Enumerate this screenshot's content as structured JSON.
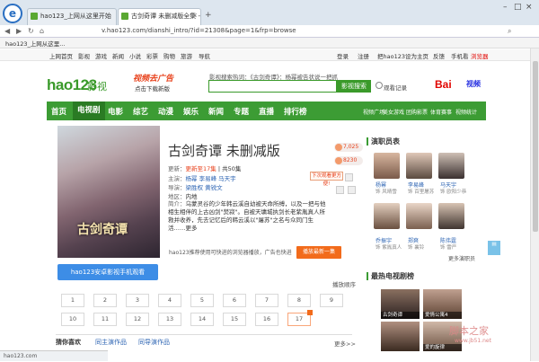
{
  "tabs": [
    {
      "label": "hao123_上网从这里开始"
    },
    {
      "label": "古剑奇谭 未删减版全集 - 更新"
    }
  ],
  "browser": {
    "url": "v.hao123.com/dianshi_intro/?id=21308&page=1&frp=browse",
    "favorite": "hao123_上网从这里..."
  },
  "topnav": {
    "items": [
      "上网首页",
      "影视",
      "游戏",
      "新闻",
      "小说",
      "彩票",
      "购物",
      "旅游",
      "导航"
    ],
    "right": [
      "登录",
      "注册",
      "把hao123设为主页",
      "反馈",
      "手机看",
      "浏览器"
    ]
  },
  "header": {
    "logo": "hao123",
    "logo_sub": "影视",
    "promo": "视频去广告",
    "promo_sub": "点击下载新版",
    "search_hint": "影视搜索热词：《古剑奇谭》：杨幂被告状说一把抓",
    "search_button": "影视搜索",
    "history": "观看记录",
    "baidu": "Bai",
    "baidu_sub": "视频"
  },
  "mainnav": {
    "items": [
      "首页",
      "电视剧",
      "电影",
      "综艺",
      "动漫",
      "娱乐",
      "新闻",
      "专题",
      "直播",
      "排行榜"
    ],
    "sub": [
      "视频广场",
      "美女",
      "游戏",
      "团购影票",
      "体育赛事",
      "视频统计"
    ]
  },
  "drama": {
    "title": "古剑奇谭  未删减版",
    "poster_title": "古剑奇谭",
    "update_label": "更新：",
    "update_value": "更新至17集",
    "total": "| 共50集",
    "cast_label": "主演：",
    "cast": "杨幂  李易峰  马天宇",
    "director_label": "导演：",
    "director": "梁胜权  黄锐文",
    "region_label": "地区：",
    "region": "内地",
    "plot_label": "简介：",
    "plot": "乌蒙灵谷的少年韩云溪自幼被天命所缚，以及一把与他相生相伴的上古凶剑\"焚寂\"。自被天墉城执剑长老紫胤真人所救并收养，先去记忆后的韩云溪以\"屠苏\"之名与众同门生活……更多",
    "stats": [
      "7,025",
      "8230"
    ],
    "tooltip": "下次观看更方便!",
    "notice": "hao123推荐使用可快进的浏览器播放，广告也快进",
    "latest_button": "播放最新一集",
    "phone_button": "hao123安卓影视手机观看",
    "sort": "播放顺序",
    "episodes": [
      "1",
      "2",
      "3",
      "4",
      "5",
      "6",
      "7",
      "8",
      "9",
      "10",
      "11",
      "12",
      "13",
      "14",
      "15",
      "16",
      "17"
    ]
  },
  "bottomtabs": {
    "items": [
      "猜你喜欢",
      "同主演作品",
      "同导演作品"
    ],
    "more": "更多>>"
  },
  "actors": {
    "heading": "演职员表",
    "list": [
      {
        "name": "杨幂",
        "role": "饰 风晴雪"
      },
      {
        "name": "李易峰",
        "role": "饰 百里屠苏"
      },
      {
        "name": "马天宇",
        "role": "饰 欧阳少恭"
      },
      {
        "name": "乔振宇",
        "role": "饰 紫胤真人"
      },
      {
        "name": "郑爽",
        "role": "饰 襄铃"
      },
      {
        "name": "陈伟霆",
        "role": "饰 雷严"
      }
    ],
    "more": "更多演职员"
  },
  "hot": {
    "heading": "最热电视剧榜",
    "list": [
      "古剑奇谭",
      "爱情公寓4",
      "",
      "",
      "",
      "爱的旋律"
    ]
  },
  "status": "hao123.com",
  "watermark": "脚本之家",
  "watermark_url": "www.jb51.net"
}
